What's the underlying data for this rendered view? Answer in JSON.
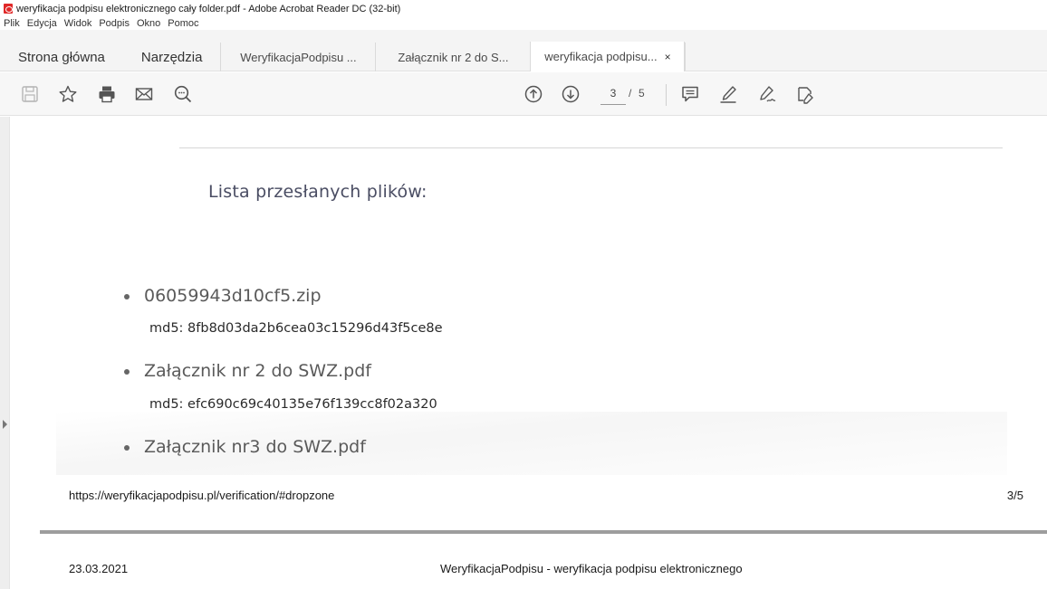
{
  "window": {
    "title": "weryfikacja podpisu elektronicznego cały folder.pdf - Adobe Acrobat Reader DC (32-bit)",
    "icon": "acrobat-pdf-icon"
  },
  "menu": [
    "Plik",
    "Edycja",
    "Widok",
    "Podpis",
    "Okno",
    "Pomoc"
  ],
  "tabs": {
    "home": "Strona główna",
    "tools": "Narzędzia",
    "documents": [
      {
        "label": "WeryfikacjaPodpisu ...",
        "active": false
      },
      {
        "label": "Załącznik nr 2 do S...",
        "active": false
      },
      {
        "label": "weryfikacja podpisu...",
        "active": true,
        "close": "×"
      }
    ]
  },
  "toolbar": {
    "left_icons": [
      "save-icon",
      "bookmark-star-icon",
      "print-icon",
      "email-icon",
      "zoom-search-icon"
    ],
    "nav_icons": [
      "page-up-icon",
      "page-down-icon"
    ],
    "current_page": "3",
    "separator": "/",
    "total_pages": "5",
    "right_icons": [
      "comment-icon",
      "highlight-pen-icon",
      "sign-icon",
      "fill-sign-icon"
    ]
  },
  "document": {
    "heading": "Lista przesłanych plików:",
    "files": [
      {
        "name": "06059943d10cf5.zip",
        "md5": "md5: 8fb8d03da2b6cea03c15296d43f5ce8e"
      },
      {
        "name": "Załącznik nr 2 do SWZ.pdf",
        "md5": "md5: efc690c69c40135e76f139cc8f02a320"
      },
      {
        "name": "Załącznik nr3 do SWZ.pdf",
        "md5": ""
      }
    ],
    "footer_url": "https://weryfikacjapodpisu.pl/verification/#dropzone",
    "footer_page": "3/5",
    "next_header_date": "23.03.2021",
    "next_header_title": "WeryfikacjaPodpisu - weryfikacja podpisu elektronicznego"
  },
  "colors": {
    "heading": "#4a4d63",
    "accent_red": "#e02828",
    "page_break": "#9d9d9d"
  }
}
